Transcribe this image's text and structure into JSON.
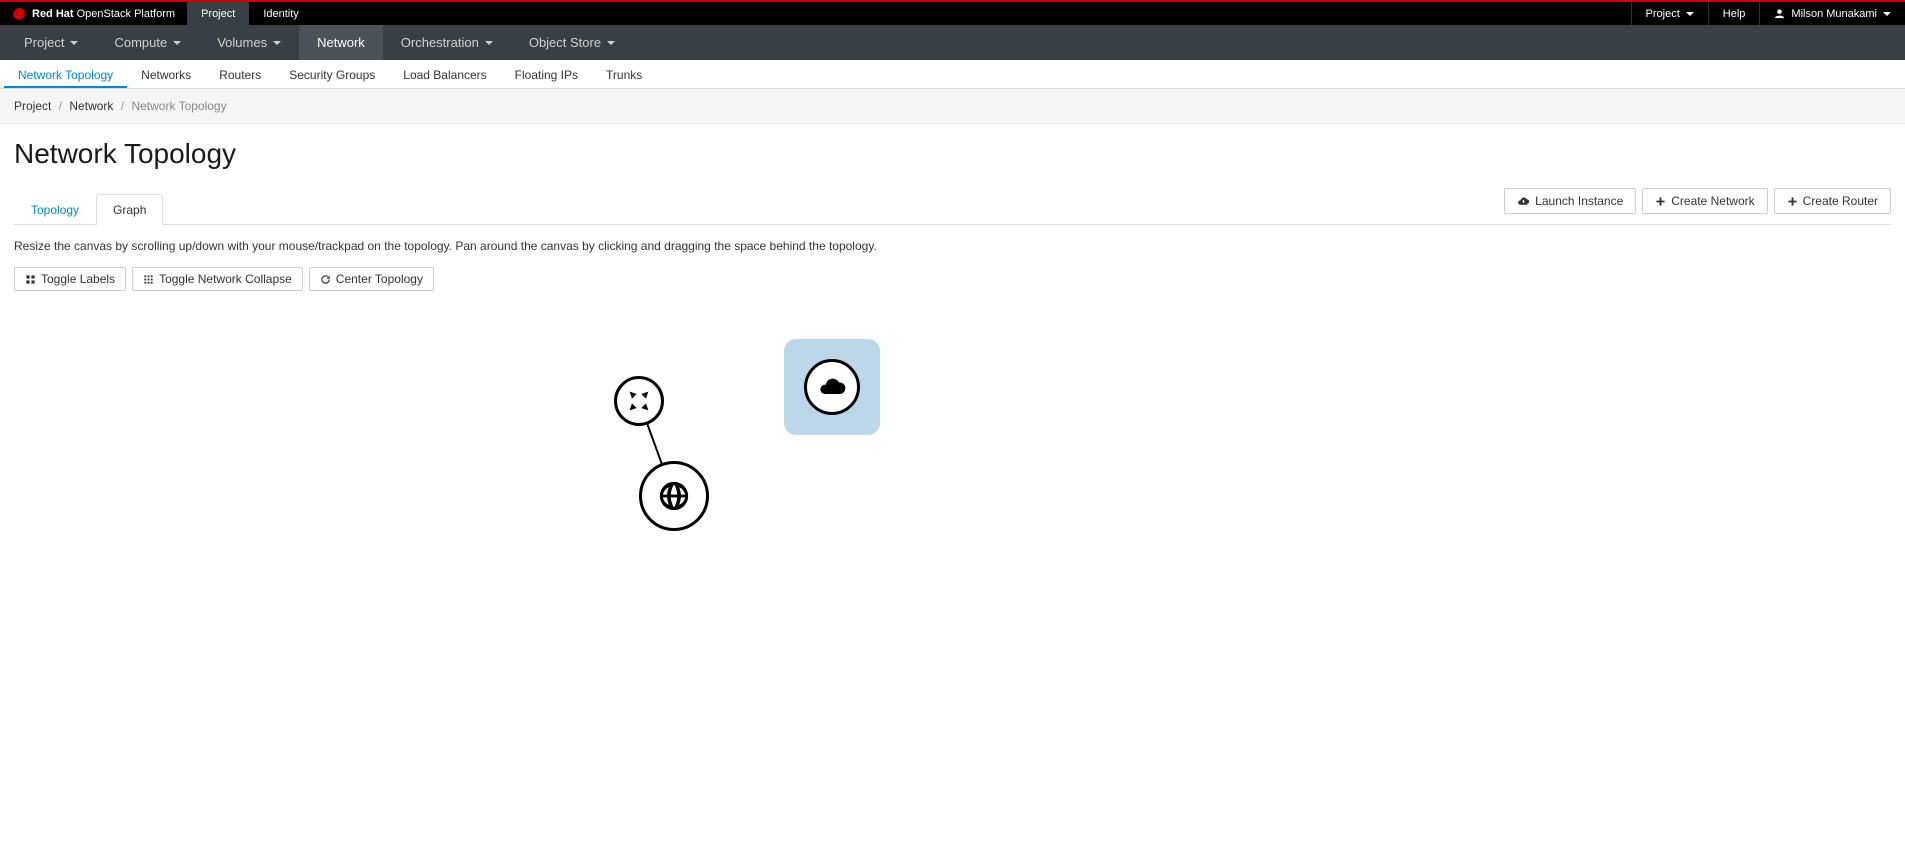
{
  "brand": {
    "name_bold": "Red Hat",
    "name_rest": " OpenStack Platform"
  },
  "top_tabs": [
    {
      "label": "Project",
      "active": true
    },
    {
      "label": "Identity",
      "active": false
    }
  ],
  "top_right": {
    "project_label": "Project",
    "help_label": "Help",
    "user_name": "Milson Munakami"
  },
  "nav": [
    {
      "label": "Project",
      "caret": true
    },
    {
      "label": "Compute",
      "caret": true
    },
    {
      "label": "Volumes",
      "caret": true
    },
    {
      "label": "Network",
      "caret": false,
      "active": true
    },
    {
      "label": "Orchestration",
      "caret": true
    },
    {
      "label": "Object Store",
      "caret": true
    }
  ],
  "subnav": [
    {
      "label": "Network Topology",
      "active": true
    },
    {
      "label": "Networks"
    },
    {
      "label": "Routers"
    },
    {
      "label": "Security Groups"
    },
    {
      "label": "Load Balancers"
    },
    {
      "label": "Floating IPs"
    },
    {
      "label": "Trunks"
    }
  ],
  "breadcrumb": {
    "items": [
      "Project",
      "Network"
    ],
    "current": "Network Topology"
  },
  "page": {
    "title": "Network Topology",
    "help": "Resize the canvas by scrolling up/down with your mouse/trackpad on the topology. Pan around the canvas by clicking and dragging the space behind the topology."
  },
  "actions": {
    "launch_instance": "Launch Instance",
    "create_network": "Create Network",
    "create_router": "Create Router"
  },
  "view_tabs": {
    "topology": "Topology",
    "graph": "Graph"
  },
  "toolbar": {
    "toggle_labels": "Toggle Labels",
    "toggle_collapse": "Toggle Network Collapse",
    "center": "Center Topology"
  }
}
